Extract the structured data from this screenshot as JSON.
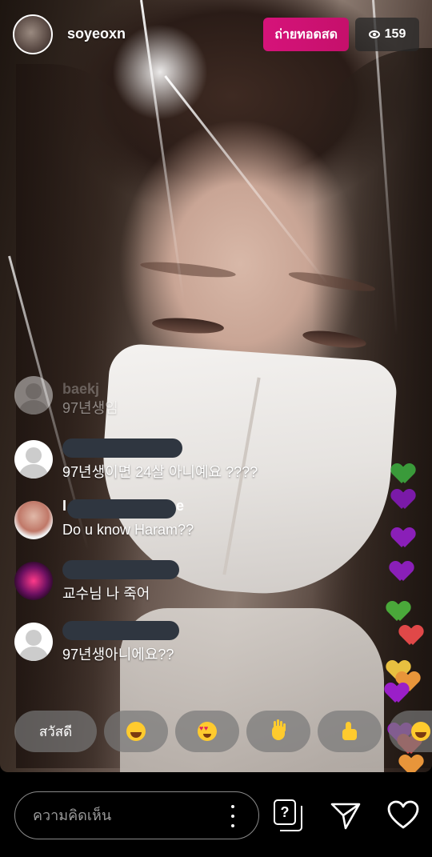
{
  "header": {
    "username": "soyeoxn",
    "live_label": "ถ่ายทอดสด",
    "viewer_count": "159"
  },
  "comments": [
    {
      "name_tail": "baekj",
      "text": "97년생임"
    },
    {
      "text": "97년생이면 24살 아니예요 ????"
    },
    {
      "name_head": "I",
      "name_tail": "e",
      "text": "Do u know Haram??"
    },
    {
      "text": "교수님 나 죽어"
    },
    {
      "text": "97년생아니에요??"
    }
  ],
  "quick_replies": {
    "hello_label": "สวัสดี",
    "emojis": [
      "laughing-emoji",
      "heart-eyes-emoji",
      "waving-hand-emoji",
      "thumbs-up-emoji",
      "laughing-emoji"
    ]
  },
  "hearts_colors": {
    "green": "#3a9a3a",
    "purple": "#8a1fb8",
    "red": "#e04848",
    "orange": "#e8953a",
    "yellow": "#e8c040"
  },
  "composer": {
    "placeholder": "ความคิดเห็น"
  },
  "icons": {
    "question": "question-icon",
    "send": "send-icon",
    "like": "heart-icon"
  }
}
